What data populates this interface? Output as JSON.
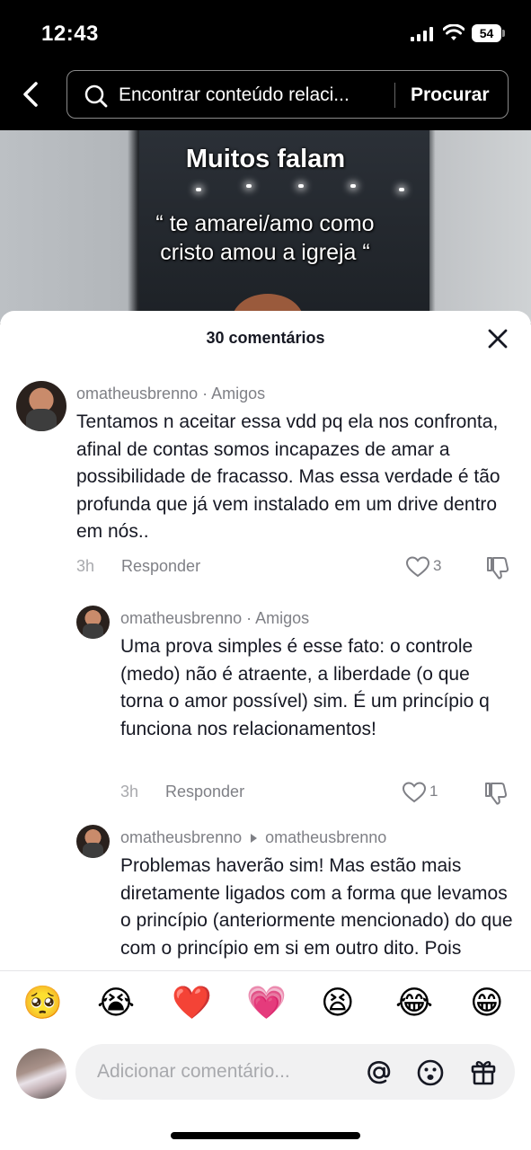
{
  "status_bar": {
    "time": "12:43",
    "battery": "54"
  },
  "search": {
    "query": "Encontrar conteúdo relaci...",
    "button": "Procurar"
  },
  "video": {
    "title": "Muitos falam",
    "caption": "“ te amarei/amo como cristo amou a igreja “"
  },
  "comments_header": {
    "title": "30 comentários"
  },
  "comments": [
    {
      "author": "omatheusbrenno",
      "tag": "· Amigos",
      "text": "Tentamos n aceitar essa vdd pq ela nos confronta, afinal de contas somos incapazes de amar a possibilidade de fracasso. Mas essa verdade é tão profunda que já vem instalado em um drive dentro em nós..",
      "time": "3h",
      "reply_label": "Responder",
      "likes": "3"
    },
    {
      "author": "omatheusbrenno",
      "tag": "· Amigos",
      "text": "Uma prova simples é esse fato: o controle (medo) não é atraente, a liberdade (o que torna o amor possível) sim. É um princípio q funciona nos relacionamentos!",
      "time": "3h",
      "reply_label": "Responder",
      "likes": "1"
    },
    {
      "author": "omatheusbrenno",
      "reply_to": "omatheusbrenno",
      "text": "Problemas haverão sim! Mas estão mais diretamente ligados com a forma que levamos o princípio (anteriormente mencionado) do que com o princípio em si em outro dito. Pois"
    }
  ],
  "emoji_bar": [
    "🥺",
    "😭",
    "❤️",
    "💗",
    "😫",
    "😂",
    "😁"
  ],
  "input": {
    "placeholder": "Adicionar comentário..."
  },
  "icons": [
    "back-icon",
    "search-icon",
    "close-icon",
    "heart-icon",
    "dislike-icon",
    "at-icon",
    "emoji-icon",
    "gift-icon"
  ]
}
